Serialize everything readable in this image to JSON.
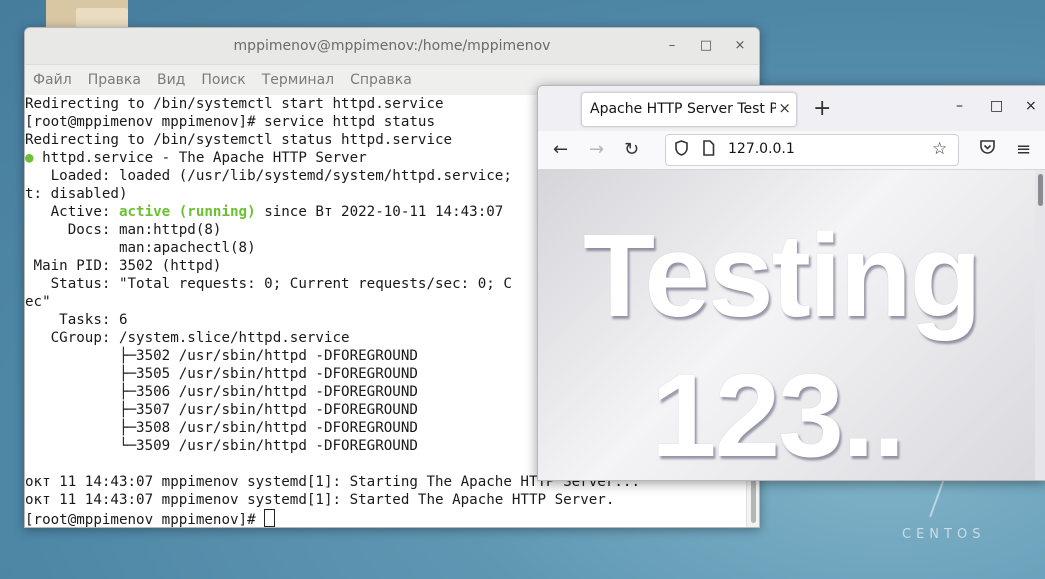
{
  "desktop": {
    "logo_text": "CENTOS"
  },
  "terminal": {
    "title": "mppimenov@mppimenov:/home/mppimenov",
    "controls": {
      "minimize": "–",
      "maximize": "□",
      "close": "×"
    },
    "menu": [
      "Файл",
      "Правка",
      "Вид",
      "Поиск",
      "Терминал",
      "Справка"
    ],
    "lines": [
      "Redirecting to /bin/systemctl start httpd.service",
      "[root@mppimenov mppimenov]# service httpd status",
      "Redirecting to /bin/systemctl status httpd.service",
      "httpd.service - The Apache HTTP Server",
      "   Loaded: loaded (/usr/lib/systemd/system/httpd.service;",
      "t: disabled)",
      "since Вт 2022-10-11 14:43:07",
      "     Docs: man:httpd(8)",
      "           man:apachectl(8)",
      " Main PID: 3502 (httpd)",
      "   Status: \"Total requests: 0; Current requests/sec: 0; C",
      "ec\"",
      "    Tasks: 6",
      "   CGroup: /system.slice/httpd.service",
      "           ├─3502 /usr/sbin/httpd -DFOREGROUND",
      "           ├─3505 /usr/sbin/httpd -DFOREGROUND",
      "           ├─3506 /usr/sbin/httpd -DFOREGROUND",
      "           ├─3507 /usr/sbin/httpd -DFOREGROUND",
      "           ├─3508 /usr/sbin/httpd -DFOREGROUND",
      "           └─3509 /usr/sbin/httpd -DFOREGROUND",
      "",
      "окт 11 14:43:07 mppimenov systemd[1]: Starting The Apache HTTP Server...",
      "окт 11 14:43:07 mppimenov systemd[1]: Started The Apache HTTP Server.",
      "[root@mppimenov mppimenov]# "
    ],
    "active_label": "   Active: ",
    "active_status": "active (running)",
    "status_dot": "●"
  },
  "browser": {
    "tab_title": "Apache HTTP Server Test Page",
    "tab_close": "×",
    "new_tab": "+",
    "controls": {
      "minimize": "–",
      "maximize": "□",
      "close": "×"
    },
    "url": "127.0.0.1",
    "page": {
      "headline_line1": "Testing",
      "headline_line2": "123.."
    }
  }
}
